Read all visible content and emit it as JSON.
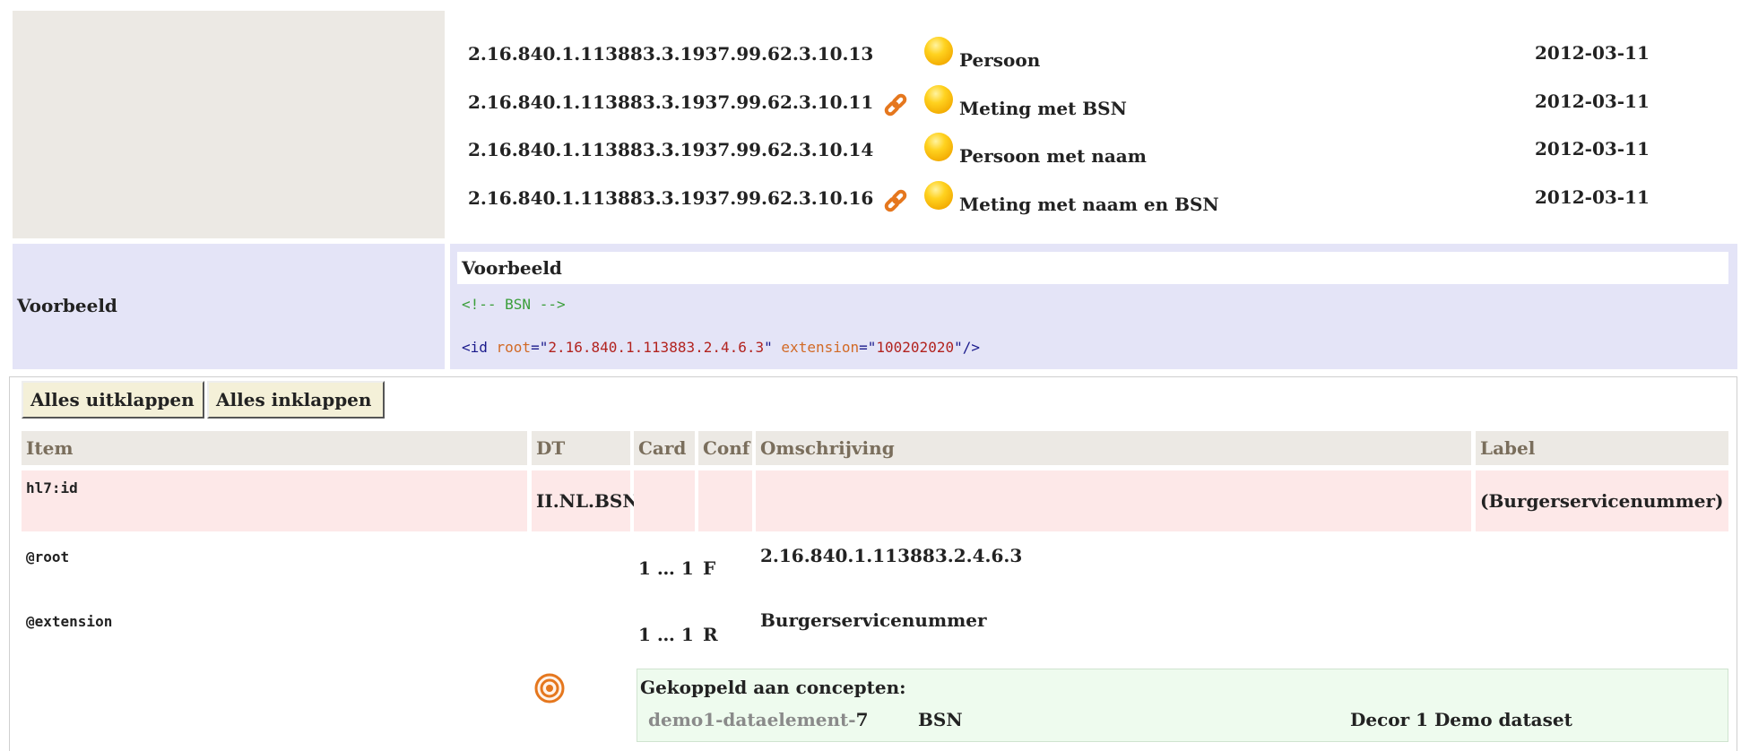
{
  "usages": [
    {
      "oid": "2.16.840.1.113883.3.1937.99.62.3.10.13",
      "linked": false,
      "status_icon": "status-draft-icon",
      "name": "Persoon",
      "date": "2012-03-11"
    },
    {
      "oid": "2.16.840.1.113883.3.1937.99.62.3.10.11",
      "linked": true,
      "status_icon": "status-draft-icon",
      "name": "Meting met BSN",
      "date": "2012-03-11"
    },
    {
      "oid": "2.16.840.1.113883.3.1937.99.62.3.10.14",
      "linked": false,
      "status_icon": "status-draft-icon",
      "name": "Persoon met naam",
      "date": "2012-03-11"
    },
    {
      "oid": "2.16.840.1.113883.3.1937.99.62.3.10.16",
      "linked": true,
      "status_icon": "status-draft-icon",
      "name": "Meting met naam en BSN",
      "date": "2012-03-11"
    }
  ],
  "example": {
    "label": "Voorbeeld",
    "title": "Voorbeeld",
    "comment": "<!-- BSN -->",
    "code": {
      "open": "<id ",
      "attr1": "root",
      "eq1": "=\"",
      "val1": "2.16.840.1.113883.2.4.6.3",
      "sep": "\" ",
      "attr2": "extension",
      "eq2": "=\"",
      "val2": "100202020",
      "close": "\"/>"
    }
  },
  "buttons": {
    "expand": "Alles uitklappen",
    "collapse": "Alles inklappen"
  },
  "table": {
    "headers": {
      "item": "Item",
      "dt": "DT",
      "card": "Card",
      "conf": "Conf",
      "desc": "Omschrijving",
      "label": "Label"
    },
    "rows": [
      {
        "item": "hl7:id",
        "dt": "II.NL.BSN",
        "card": "",
        "conf": "",
        "desc": "",
        "label": "(Burgerservicenummer)"
      },
      {
        "item": "@root",
        "dt": "",
        "card": "1 … 1",
        "conf": "F",
        "desc": "2.16.840.1.113883.2.4.6.3",
        "label": ""
      },
      {
        "item": "@extension",
        "dt": "",
        "card": "1 … 1",
        "conf": "R",
        "desc": "Burgerservicenummer",
        "label": ""
      }
    ]
  },
  "concepts": {
    "icon": "target-icon",
    "title": "Gekoppeld aan concepten:",
    "id_prefix": "demo1-dataelement-",
    "id_number": "7",
    "name": "BSN",
    "dataset": "Decor 1 Demo dataset"
  },
  "colors": {
    "example_bg": "#e4e4f7",
    "header_bg": "#ece9e4",
    "row_highlight": "#fde8e8",
    "concept_bg": "#eefbee",
    "link_icon": "#e5771e",
    "status_icon": "#ffc400"
  }
}
